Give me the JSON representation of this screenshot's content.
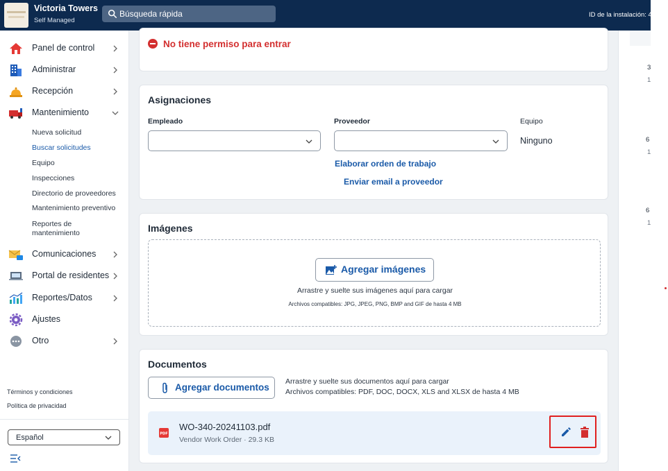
{
  "header": {
    "property_name": "Victoria Towers",
    "property_type": "Self Managed",
    "search_label": "Búsqueda rápida",
    "install_id_label": "ID de la instalación: 4"
  },
  "sidebar": {
    "items": [
      {
        "label": "Panel de control",
        "icon": "house-icon"
      },
      {
        "label": "Administrar",
        "icon": "building-icon"
      },
      {
        "label": "Recepción",
        "icon": "reception-bell-icon"
      },
      {
        "label": "Mantenimiento",
        "icon": "maintenance-truck-icon"
      },
      {
        "label": "Comunicaciones",
        "icon": "envelope-icon"
      },
      {
        "label": "Portal de residentes",
        "icon": "laptop-icon"
      },
      {
        "label": "Reportes/Datos",
        "icon": "bar-chart-icon"
      },
      {
        "label": "Ajustes",
        "icon": "gear-icon"
      },
      {
        "label": "Otro",
        "icon": "more-icon"
      }
    ],
    "maintenance_sub": [
      "Nueva solicitud",
      "Buscar solicitudes",
      "Equipo",
      "Inspecciones",
      "Directorio de proveedores",
      "Mantenimiento preventivo",
      "Reportes de mantenimiento"
    ],
    "terms": "Términos y condiciones",
    "privacy": "Política de privacidad",
    "language": "Español"
  },
  "permission": {
    "message": "No tiene permiso para entrar"
  },
  "assignments": {
    "title": "Asignaciones",
    "employee_label": "Empleado",
    "provider_label": "Proveedor",
    "equipment_label": "Equipo",
    "equipment_value": "Ninguno",
    "work_order_link": "Elaborar orden de trabajo",
    "email_provider_link": "Enviar email a proveedor"
  },
  "images": {
    "title": "Imágenes",
    "add_button": "Agregar imágenes",
    "drop_hint": "Arrastre y suelte sus imágenes aquí para cargar",
    "formats": "Archivos compatibles: JPG, JPEG, PNG, BMP and GIF de hasta 4 MB"
  },
  "documents": {
    "title": "Documentos",
    "add_button": "Agregar documentos",
    "drop_hint": "Arrastre y suelte sus documentos aquí para cargar",
    "formats": "Archivos compatibles: PDF, DOC, DOCX, XLS and XLSX de hasta 4 MB",
    "files": [
      {
        "name": "WO-340-20241103.pdf",
        "meta": "Vendor Work Order · 29.3 KB"
      }
    ]
  },
  "right_panel": {
    "lines": [
      "3",
      "1",
      "6",
      "1",
      "6",
      "1"
    ]
  },
  "colors": {
    "topbar": "#0d2a4f",
    "link_blue": "#1a5aa8",
    "danger_red": "#d32f2f",
    "file_row_bg": "#eaf2fb"
  }
}
